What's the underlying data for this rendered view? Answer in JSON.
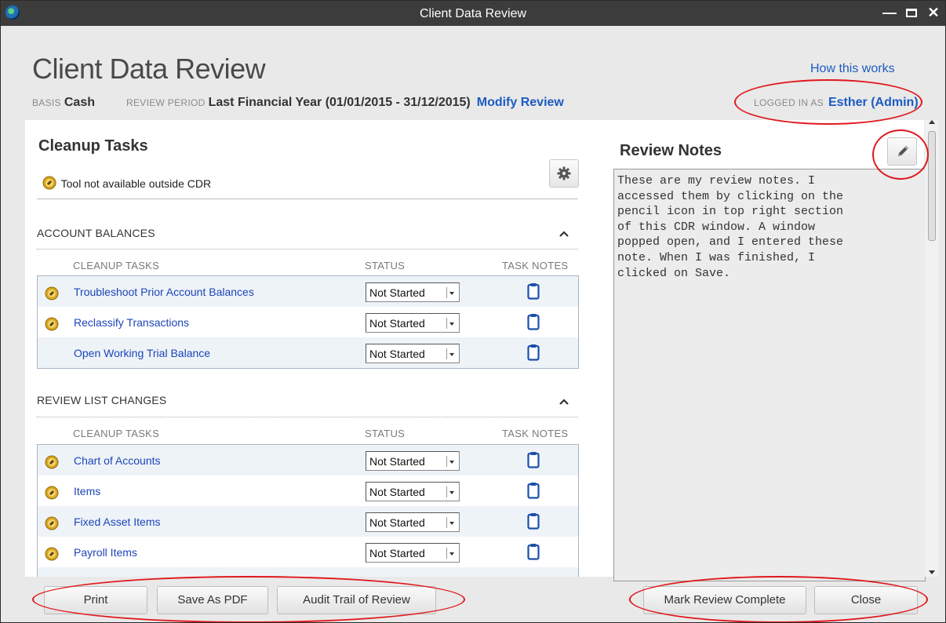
{
  "window": {
    "title": "Client Data Review",
    "controls": {
      "minimize": "minimize-icon",
      "maximize": "maximize-icon",
      "close": "close-icon"
    }
  },
  "header": {
    "page_title": "Client Data Review",
    "help_link": "How this works",
    "basis_label": "BASIS",
    "basis_value": "Cash",
    "period_label": "REVIEW PERIOD",
    "period_value": "Last Financial Year (01/01/2015 - 31/12/2015)",
    "modify_link": "Modify Review",
    "logged_label": "LOGGED IN AS",
    "logged_user": "Esther (Admin)"
  },
  "cleanup": {
    "title": "Cleanup Tasks",
    "legend": "Tool not available outside CDR",
    "sections": [
      {
        "title": "ACCOUNT BALANCES",
        "col_task": "CLEANUP TASKS",
        "col_status": "STATUS",
        "col_notes": "TASK NOTES",
        "rows": [
          {
            "label": "Troubleshoot Prior Account Balances",
            "status": "Not Started"
          },
          {
            "label": "Reclassify Transactions",
            "status": "Not Started"
          },
          {
            "label": "Open Working Trial Balance",
            "status": "Not Started"
          }
        ]
      },
      {
        "title": "REVIEW LIST CHANGES",
        "col_task": "CLEANUP TASKS",
        "col_status": "STATUS",
        "col_notes": "TASK NOTES",
        "rows": [
          {
            "label": "Chart of Accounts",
            "status": "Not Started"
          },
          {
            "label": "Items",
            "status": "Not Started"
          },
          {
            "label": "Fixed Asset Items",
            "status": "Not Started"
          },
          {
            "label": "Payroll Items",
            "status": "Not Started"
          }
        ]
      }
    ]
  },
  "notes": {
    "title": "Review Notes",
    "text": "These are my review notes. I\naccessed them by clicking on the\npencil icon in top right section\nof this CDR window. A window\npopped open, and I entered these\nnote. When I was finished, I\nclicked on Save."
  },
  "footer": {
    "print": "Print",
    "save_pdf": "Save As PDF",
    "audit_trail": "Audit Trail of Review",
    "mark_complete": "Mark Review Complete",
    "close": "Close"
  },
  "colors": {
    "link": "#1d5bc2",
    "annotation": "#e0181c",
    "titlebar": "#3c3c3c"
  }
}
